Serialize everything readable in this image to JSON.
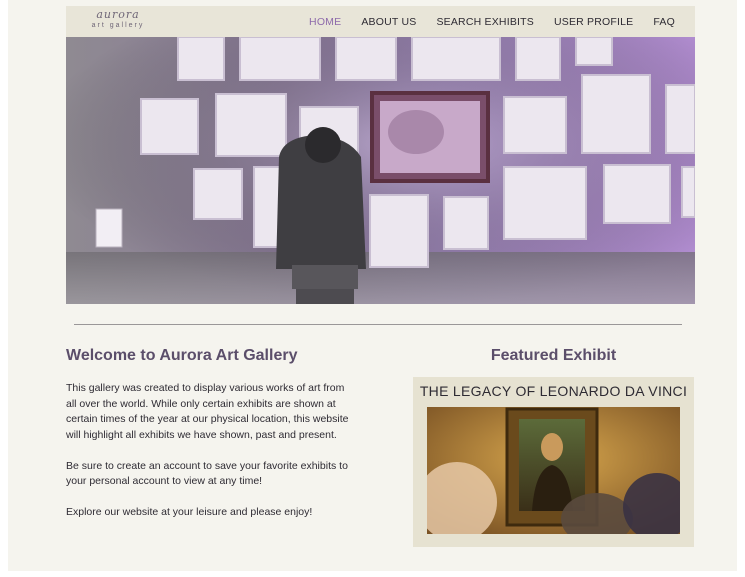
{
  "logo": {
    "script": "aurora",
    "sub": "art gallery"
  },
  "nav": [
    {
      "label": "HOME",
      "active": true
    },
    {
      "label": "ABOUT US",
      "active": false
    },
    {
      "label": "SEARCH EXHIBITS",
      "active": false
    },
    {
      "label": "USER PROFILE",
      "active": false
    },
    {
      "label": "FAQ",
      "active": false
    }
  ],
  "welcome": {
    "title": "Welcome to Aurora Art Gallery",
    "paragraphs": [
      "This gallery was created to display various works of art from all over the world. While only certain exhibits are shown at certain times of the year at our physical location, this website will highlight all exhibits we have shown, past and present.",
      "Be sure to create an account to save your favorite exhibits to your personal account to view at any time!",
      "Explore our website at your leisure and please enjoy!"
    ]
  },
  "featured": {
    "title": "Featured Exhibit",
    "caption": "THE LEGACY OF LEONARDO DA VINCI"
  },
  "colors": {
    "accent": "#8e6bab",
    "nav_bg": "#e8e5d8",
    "page_bg": "#f5f4ee",
    "heading": "#5b4e6a"
  }
}
